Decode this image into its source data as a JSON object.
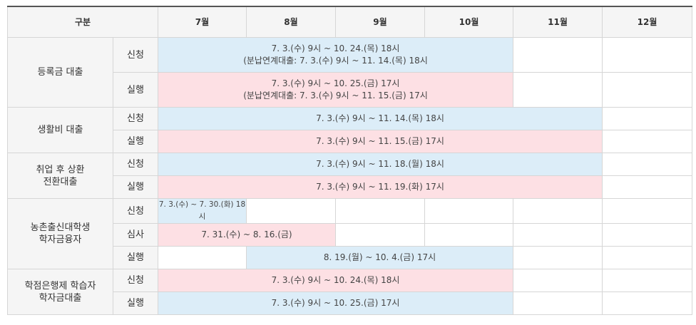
{
  "header": {
    "category": "구분",
    "months": [
      "7월",
      "8월",
      "9월",
      "10월",
      "11월",
      "12월"
    ]
  },
  "tuition": {
    "name": "등록금 대출",
    "apply_label": "신청",
    "apply_line1": "7. 3.(수) 9시 ~ 10. 24.(목) 18시",
    "apply_line2": "(분납연계대출: 7. 3.(수) 9시 ~ 11. 14.(목) 18시",
    "exec_label": "실행",
    "exec_line1": "7. 3.(수) 9시 ~ 10. 25.(금) 17시",
    "exec_line2": "(분납연계대출: 7. 3.(수) 9시 ~ 11. 15.(금) 17시"
  },
  "living": {
    "name": "생활비 대출",
    "apply_label": "신청",
    "apply_period": "7. 3.(수) 9시 ~ 11. 14.(목) 18시",
    "exec_label": "실행",
    "exec_period": "7. 3.(수) 9시 ~ 11. 15.(금) 17시"
  },
  "icl": {
    "name_line1": "취업 후 상환",
    "name_line2": "전환대출",
    "apply_label": "신청",
    "apply_period": "7. 3.(수) 9시 ~ 11. 18.(월) 18시",
    "exec_label": "실행",
    "exec_period": "7. 3.(수) 9시 ~ 11. 19.(화) 17시"
  },
  "rural": {
    "name_line1": "농촌출신대학생",
    "name_line2": "학자금융자",
    "apply_label": "신청",
    "apply_period": "7. 3.(수) ~ 7. 30.(화) 18시",
    "review_label": "심사",
    "review_period": "7. 31.(수) ~ 8. 16.(금)",
    "exec_label": "실행",
    "exec_period": "8. 19.(월) ~ 10. 4.(금) 17시"
  },
  "credit_bank": {
    "name_line1": "학점은행제 학습자",
    "name_line2": "학자금대출",
    "apply_label": "신청",
    "apply_period": "7. 3.(수) 9시 ~ 10. 24.(목) 18시",
    "exec_label": "실행",
    "exec_period": "7. 3.(수) 9시 ~ 10. 25.(금) 17시"
  },
  "colors": {
    "apply_bg": "#dcedf8",
    "exec_bg": "#fde0e4",
    "header_bg": "#f5f5f5",
    "border": "#d6d6d6"
  }
}
